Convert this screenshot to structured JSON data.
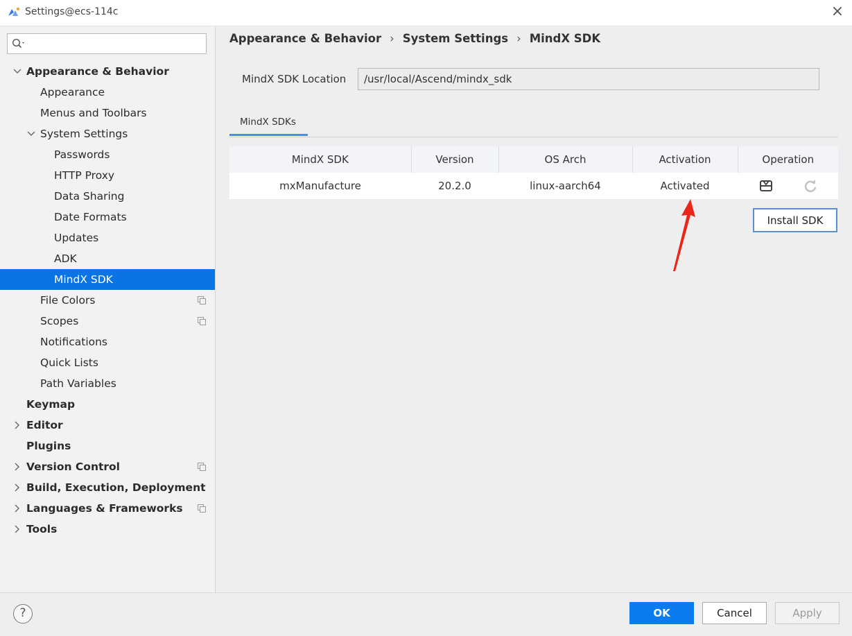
{
  "window": {
    "title": "Settings@ecs-114c",
    "close_glyph": "×"
  },
  "search": {
    "value": "",
    "placeholder": ""
  },
  "sidebar": {
    "items": [
      {
        "label": "Appearance & Behavior",
        "level": 0,
        "bold": true,
        "expander": "expanded"
      },
      {
        "label": "Appearance",
        "level": 1
      },
      {
        "label": "Menus and Toolbars",
        "level": 1
      },
      {
        "label": "System Settings",
        "level": 1,
        "expander": "expanded"
      },
      {
        "label": "Passwords",
        "level": 2
      },
      {
        "label": "HTTP Proxy",
        "level": 2
      },
      {
        "label": "Data Sharing",
        "level": 2
      },
      {
        "label": "Date Formats",
        "level": 2
      },
      {
        "label": "Updates",
        "level": 2
      },
      {
        "label": "ADK",
        "level": 2
      },
      {
        "label": "MindX SDK",
        "level": 2,
        "selected": true
      },
      {
        "label": "File Colors",
        "level": 1,
        "copy_icon": true
      },
      {
        "label": "Scopes",
        "level": 1,
        "copy_icon": true
      },
      {
        "label": "Notifications",
        "level": 1
      },
      {
        "label": "Quick Lists",
        "level": 1
      },
      {
        "label": "Path Variables",
        "level": 1
      },
      {
        "label": "Keymap",
        "level": 0,
        "bold": true
      },
      {
        "label": "Editor",
        "level": 0,
        "bold": true,
        "expander": "collapsed"
      },
      {
        "label": "Plugins",
        "level": 0,
        "bold": true
      },
      {
        "label": "Version Control",
        "level": 0,
        "bold": true,
        "expander": "collapsed",
        "copy_icon": true
      },
      {
        "label": "Build, Execution, Deployment",
        "level": 0,
        "bold": true,
        "expander": "collapsed"
      },
      {
        "label": "Languages & Frameworks",
        "level": 0,
        "bold": true,
        "expander": "collapsed",
        "copy_icon": true
      },
      {
        "label": "Tools",
        "level": 0,
        "bold": true,
        "expander": "collapsed"
      }
    ]
  },
  "breadcrumb": {
    "items": [
      "Appearance & Behavior",
      "System Settings",
      "MindX SDK"
    ],
    "separator": "›"
  },
  "location": {
    "label": "MindX SDK Location",
    "value": "/usr/local/Ascend/mindx_sdk"
  },
  "tabs": [
    {
      "label": "MindX SDKs",
      "active": true
    }
  ],
  "table": {
    "headers": [
      "MindX SDK",
      "Version",
      "OS Arch",
      "Activation",
      "Operation"
    ],
    "rows": [
      {
        "sdk": "mxManufacture",
        "version": "20.2.0",
        "arch": "linux-aarch64",
        "activation": "Activated"
      }
    ]
  },
  "install_button": {
    "label": "Install SDK"
  },
  "buttons": {
    "help": "?",
    "ok": "OK",
    "cancel": "Cancel",
    "apply": "Apply"
  },
  "colors": {
    "selection": "#0b74e5",
    "ok_button": "#0b7cf0",
    "annotation_arrow": "#e8261c"
  },
  "icons": {
    "activate_op": "activate-sdk-icon",
    "refresh_op": "refresh-icon",
    "copy": "project-scope-icon",
    "search": "search-icon"
  }
}
